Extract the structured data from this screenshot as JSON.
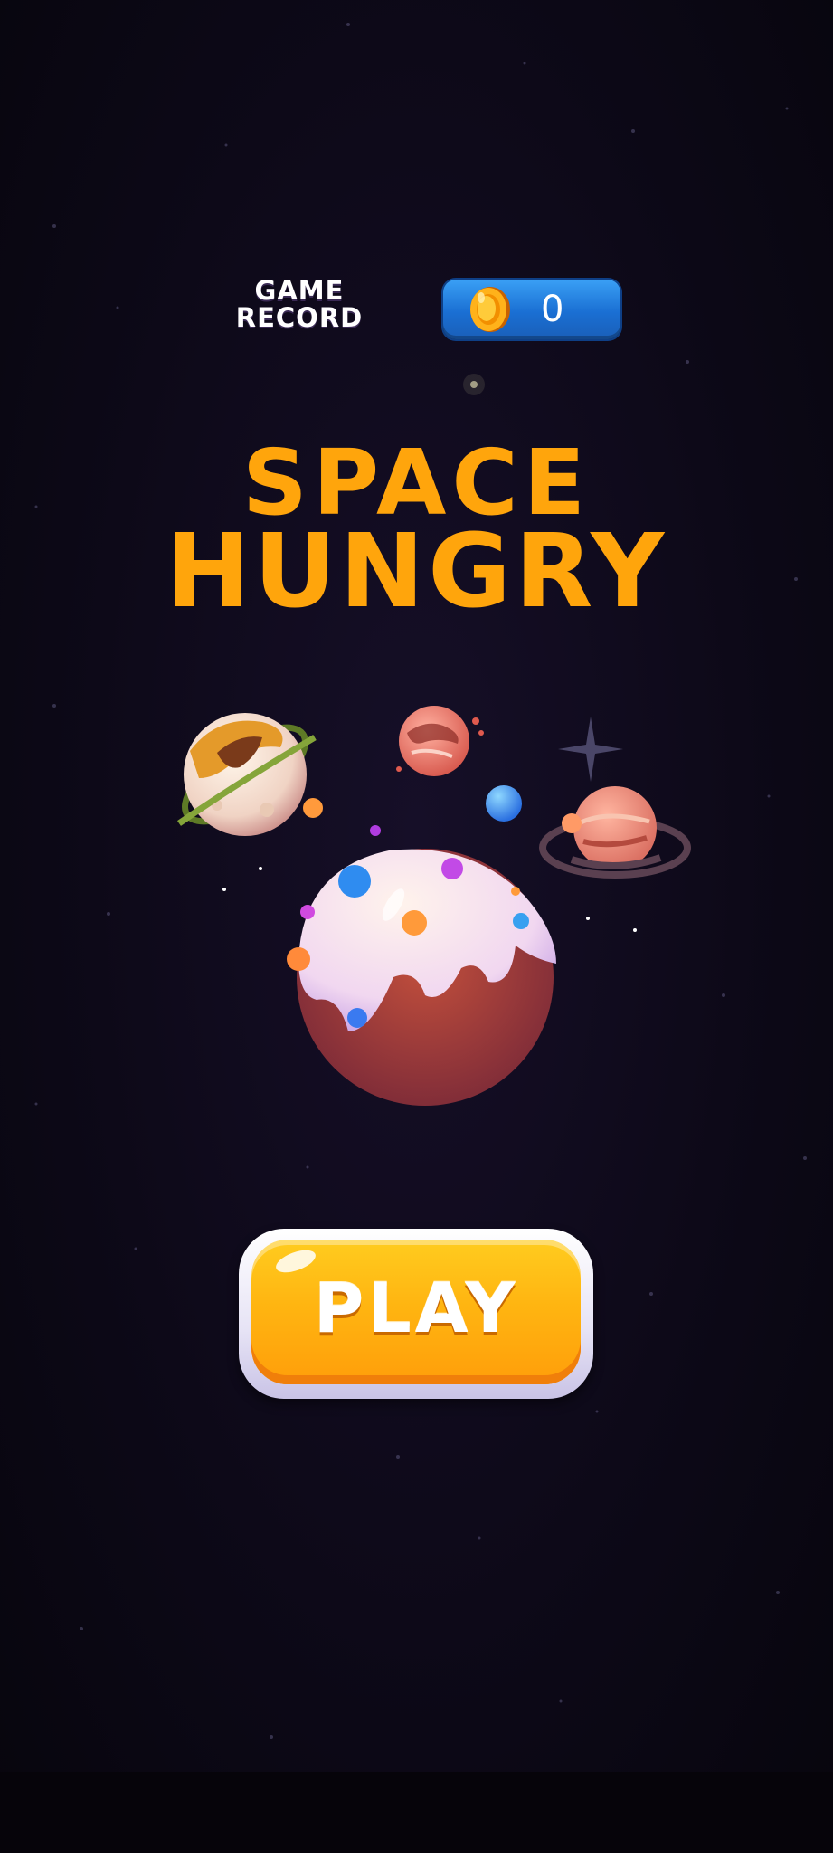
{
  "header": {
    "record_line1": "GAME",
    "record_line2": "RECORD",
    "coin_count": "0"
  },
  "title": {
    "line1": "SPACE",
    "line2": "HUNGRY"
  },
  "play_button": {
    "label": "PLAY"
  },
  "icons": {
    "coin": "coin-icon",
    "star": "sparkle-star-icon"
  },
  "colors": {
    "background": "#0e0a1a",
    "title": "#ffa50c",
    "coin_pill": "#1a6fd3",
    "play_button": "#ffb511"
  }
}
